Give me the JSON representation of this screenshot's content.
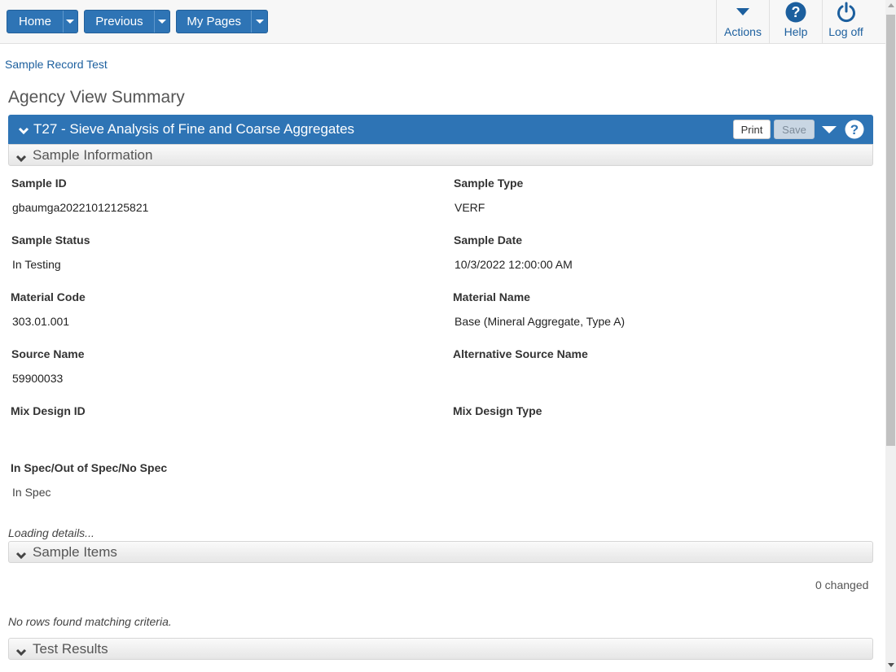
{
  "nav": {
    "home": "Home",
    "previous": "Previous",
    "my_pages": "My Pages"
  },
  "top_actions": {
    "actions": "Actions",
    "help": "Help",
    "logoff": "Log off"
  },
  "breadcrumb": "Sample Record Test",
  "page_title": "Agency View Summary",
  "panel": {
    "title": "T27 - Sieve Analysis of Fine and Coarse Aggregates",
    "print": "Print",
    "save": "Save"
  },
  "sections": {
    "sample_information": "Sample Information",
    "sample_items": "Sample Items",
    "test_results": "Test Results"
  },
  "fields": {
    "sample_id": {
      "label": "Sample ID",
      "value": "gbaumga20221012125821"
    },
    "sample_type": {
      "label": "Sample Type",
      "value": "VERF"
    },
    "sample_status": {
      "label": "Sample Status",
      "value": "In Testing"
    },
    "sample_date": {
      "label": "Sample Date",
      "value": "10/3/2022 12:00:00 AM"
    },
    "material_code": {
      "label": "Material Code",
      "value": "303.01.001"
    },
    "material_name": {
      "label": "Material Name",
      "value": "Base (Mineral Aggregate, Type A)"
    },
    "source_name": {
      "label": "Source Name",
      "value": "59900033"
    },
    "alt_source_name": {
      "label": "Alternative Source Name",
      "value": ""
    },
    "mix_design_id": {
      "label": "Mix Design ID",
      "value": ""
    },
    "mix_design_type": {
      "label": "Mix Design Type",
      "value": ""
    },
    "spec": {
      "label": "In Spec/Out of Spec/No Spec",
      "value": "In Spec"
    }
  },
  "loading_text": "Loading details...",
  "changed_text": "0 changed",
  "no_rows_text": "No rows found matching criteria.",
  "colors": {
    "primary": "#2e74b5",
    "link": "#1c5f9e"
  }
}
